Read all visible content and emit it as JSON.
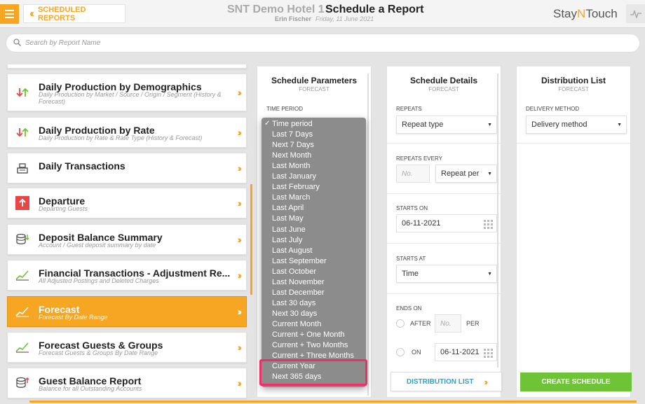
{
  "header": {
    "back_label": "SCHEDULED REPORTS",
    "hotel_name": "SNT Demo Hotel 1",
    "page_title": "Schedule a Report",
    "user_name": "Erin Fischer",
    "date": "Friday, 11 June 2021",
    "logo_part1": "Stay",
    "logo_part2": "N",
    "logo_part3": "Touch"
  },
  "search": {
    "placeholder": "Search by Report Name"
  },
  "reports": [
    {
      "title": "Daily Production by Demographics",
      "subtitle": "Daily Production by Market / Source / Origin / Segment (History & Forecast)",
      "icon": "up-down-arrows-icon"
    },
    {
      "title": "Daily Production by Rate",
      "subtitle": "Daily Production by Rate & Rate Type (History & Forecast)",
      "icon": "up-down-arrows-icon"
    },
    {
      "title": "Daily Transactions",
      "subtitle": "",
      "icon": "cash-register-icon"
    },
    {
      "title": "Departure",
      "subtitle": "Departing Guests",
      "icon": "departure-arrow-icon"
    },
    {
      "title": "Deposit Balance Summary",
      "subtitle": "Account / Guest deposit summary by date",
      "icon": "coin-stack-icon"
    },
    {
      "title": "Financial Transactions - Adjustment Re...",
      "subtitle": "All Adjusted Postings and Deleted Charges",
      "icon": "trend-chart-icon"
    },
    {
      "title": "Forecast",
      "subtitle": "Forecast By Date Range",
      "icon": "trend-chart-icon"
    },
    {
      "title": "Forecast Guests & Groups",
      "subtitle": "Forecast Guests & Groups By Date Range",
      "icon": "trend-chart-icon"
    },
    {
      "title": "Guest Balance Report",
      "subtitle": "Balance for all Outstanding Accounts",
      "icon": "coin-stack-icon"
    }
  ],
  "schedule_parameters": {
    "title": "Schedule Parameters",
    "subtitle": "FORECAST",
    "time_period_label": "TIME PERIOD",
    "options": [
      "Time period",
      "Last 7 Days",
      "Next 7 Days",
      "Next Month",
      "Last Month",
      "Last January",
      "Last February",
      "Last March",
      "Last April",
      "Last May",
      "Last June",
      "Last July",
      "Last August",
      "Last September",
      "Last October",
      "Last November",
      "Last December",
      "Last 30 days",
      "Next 30 days",
      "Current Month",
      "Current + One Month",
      "Current + Two Months",
      "Current + Three Months",
      "Current Year",
      "Next 365 days"
    ],
    "selected_option": "Time period"
  },
  "schedule_details": {
    "title": "Schedule Details",
    "subtitle": "FORECAST",
    "repeats_label": "REPEATS",
    "repeats_value": "Repeat type",
    "repeats_every_label": "REPEATS EVERY",
    "repeats_every_placeholder": "No.",
    "repeat_per_value": "Repeat per",
    "starts_on_label": "STARTS ON",
    "starts_on_value": "06-11-2021",
    "starts_at_label": "STARTS AT",
    "starts_at_value": "Time",
    "ends_on_label": "ENDS ON",
    "after_label": "AFTER",
    "after_placeholder": "No.",
    "per_label": "PER",
    "on_label": "ON",
    "on_date_value": "06-11-2021",
    "distribution_button": "DISTRIBUTION LIST"
  },
  "distribution_list": {
    "title": "Distribution List",
    "subtitle": "FORECAST",
    "delivery_method_label": "DELIVERY METHOD",
    "delivery_method_value": "Delivery method",
    "create_button": "CREATE SCHEDULE"
  },
  "colors": {
    "accent": "#f6a623",
    "create": "#6ec336",
    "link": "#2aa3d0",
    "highlight": "#ef2e68",
    "dropdown_bg": "#8c8c8c"
  }
}
